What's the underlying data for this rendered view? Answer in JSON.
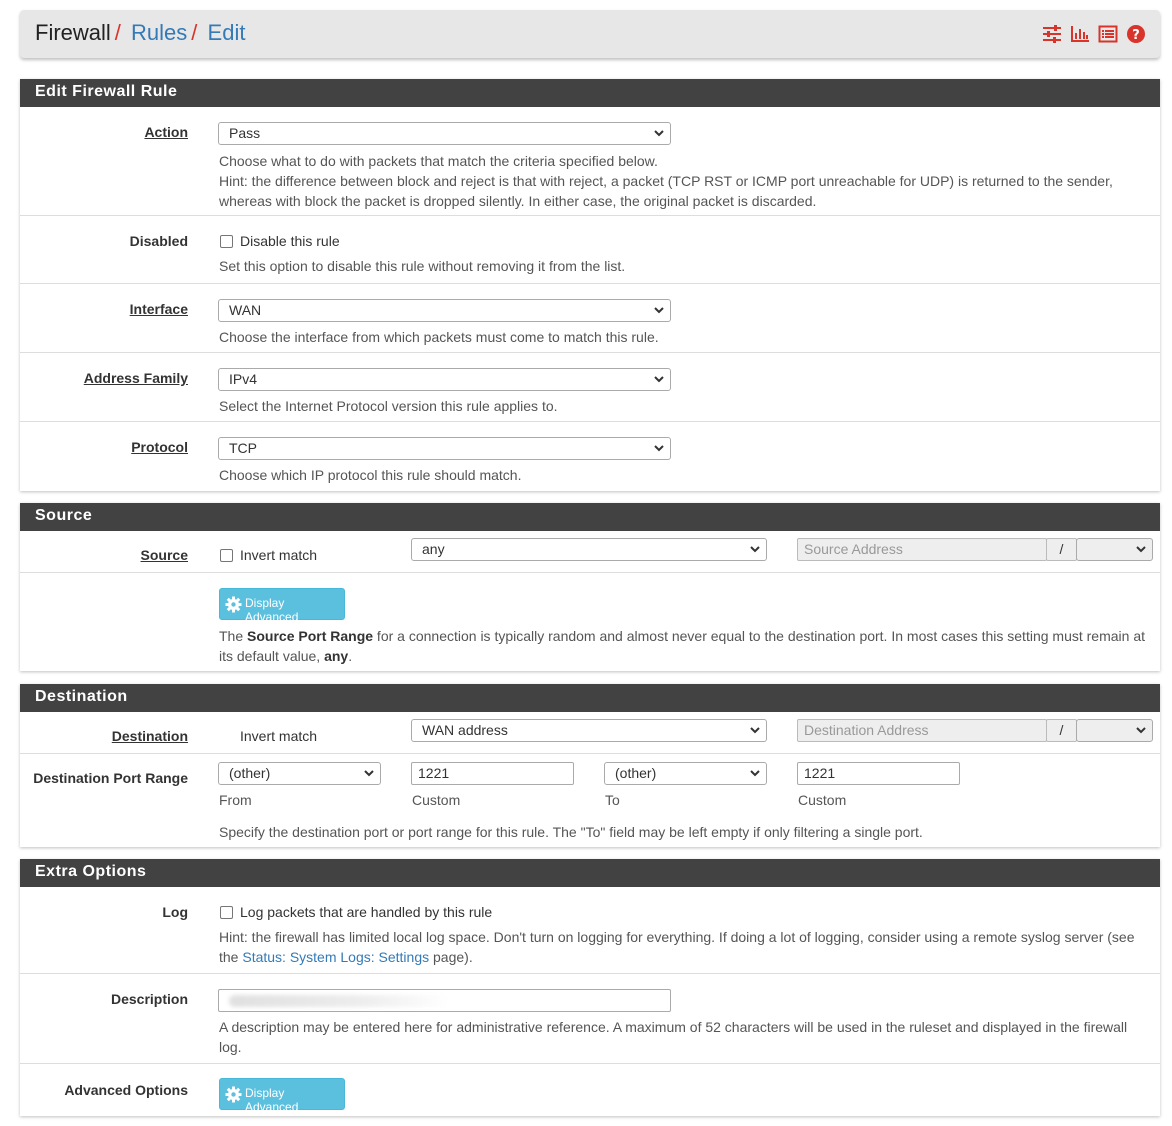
{
  "breadcrumb": {
    "first": "Firewall",
    "sep": "/",
    "second": "Rules",
    "third": "Edit"
  },
  "header_icons": [
    "sliders-icon",
    "bar-chart-icon",
    "list-icon",
    "help-icon"
  ],
  "colors": {
    "heading": "#424242",
    "link": "#337ab7",
    "accent_red": "#d9342b",
    "info_button": "#5bc0de"
  },
  "edit_rule": {
    "title": "Edit Firewall Rule",
    "action": {
      "label": "Action",
      "value": "Pass",
      "help1": "Choose what to do with packets that match the criteria specified below.",
      "help2": "Hint: the difference between block and reject is that with reject, a packet (TCP RST or ICMP port unreachable for UDP) is returned to the sender, whereas with block the packet is dropped silently. In either case, the original packet is discarded."
    },
    "disabled": {
      "label": "Disabled",
      "checkbox": "Disable this rule",
      "help": "Set this option to disable this rule without removing it from the list."
    },
    "interface": {
      "label": "Interface",
      "value": "WAN",
      "help": "Choose the interface from which packets must come to match this rule."
    },
    "address_family": {
      "label": "Address Family",
      "value": "IPv4",
      "help": "Select the Internet Protocol version this rule applies to."
    },
    "protocol": {
      "label": "Protocol",
      "value": "TCP",
      "help": "Choose which IP protocol this rule should match."
    }
  },
  "source": {
    "title": "Source",
    "label": "Source",
    "invert": "Invert match",
    "type": "any",
    "address_placeholder": "Source Address",
    "slash": "/",
    "advanced_button": "Display Advanced",
    "help_pre": "The ",
    "help_bold": "Source Port Range",
    "help_mid": " for a connection is typically random and almost never equal to the destination port. In most cases this setting must remain at its default value, ",
    "help_bold2": "any",
    "help_end": "."
  },
  "destination": {
    "title": "Destination",
    "label": "Destination",
    "invert": "Invert match",
    "type": "WAN address",
    "address_placeholder": "Destination Address",
    "slash": "/",
    "port_label": "Destination Port Range",
    "from_select": "(other)",
    "from_custom": "1221",
    "to_select": "(other)",
    "to_custom": "1221",
    "from_sub": "From",
    "custom_sub": "Custom",
    "to_sub": "To",
    "custom_sub2": "Custom",
    "help": "Specify the destination port or port range for this rule. The \"To\" field may be left empty if only filtering a single port."
  },
  "extra": {
    "title": "Extra Options",
    "log": {
      "label": "Log",
      "checkbox": "Log packets that are handled by this rule",
      "help_pre": "Hint: the firewall has limited local log space. Don't turn on logging for everything. If doing a lot of logging, consider using a remote syslog server (see the ",
      "help_link": "Status: System Logs: Settings",
      "help_end": " page)."
    },
    "description": {
      "label": "Description",
      "help": "A description may be entered here for administrative reference. A maximum of 52 characters will be used in the ruleset and displayed in the firewall log."
    },
    "advanced": {
      "label": "Advanced Options",
      "button": "Display Advanced"
    }
  }
}
